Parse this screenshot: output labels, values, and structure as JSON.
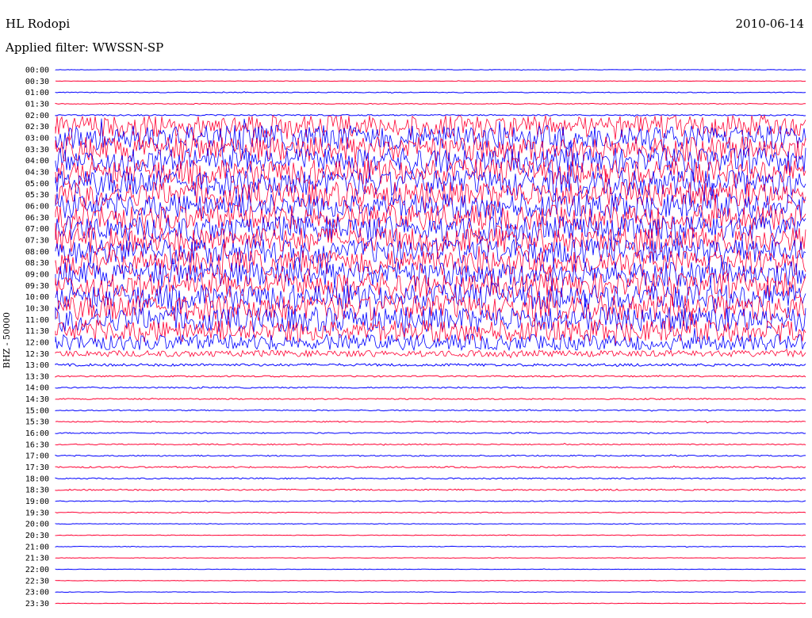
{
  "header": {
    "station": "HL Rodopi",
    "filter": "Applied filter: WWSSN-SP",
    "date": "2010-06-14"
  },
  "chart_data": {
    "type": "line",
    "ylabel": "BHZ - 50000",
    "series_colors": [
      "#0000ff",
      "#ff0033"
    ],
    "rows": [
      {
        "time": "00:00",
        "noise": 0.3
      },
      {
        "time": "00:30",
        "noise": 0.3
      },
      {
        "time": "01:00",
        "noise": 0.5
      },
      {
        "time": "01:30",
        "noise": 0.5
      },
      {
        "time": "02:00",
        "noise": 0.8
      },
      {
        "time": "02:30",
        "noise": 14
      },
      {
        "time": "03:00",
        "noise": 16
      },
      {
        "time": "03:30",
        "noise": 16
      },
      {
        "time": "04:00",
        "noise": 16
      },
      {
        "time": "04:30",
        "noise": 16
      },
      {
        "time": "05:00",
        "noise": 16
      },
      {
        "time": "05:30",
        "noise": 16
      },
      {
        "time": "06:00",
        "noise": 16
      },
      {
        "time": "06:30",
        "noise": 16
      },
      {
        "time": "07:00",
        "noise": 16
      },
      {
        "time": "07:30",
        "noise": 16
      },
      {
        "time": "08:00",
        "noise": 16
      },
      {
        "time": "08:30",
        "noise": 16
      },
      {
        "time": "09:00",
        "noise": 16
      },
      {
        "time": "09:30",
        "noise": 16
      },
      {
        "time": "10:00",
        "noise": 16
      },
      {
        "time": "10:30",
        "noise": 16
      },
      {
        "time": "11:00",
        "noise": 16
      },
      {
        "time": "11:30",
        "noise": 14
      },
      {
        "time": "12:00",
        "noise": 10
      },
      {
        "time": "12:30",
        "noise": 4
      },
      {
        "time": "13:00",
        "noise": 1.6
      },
      {
        "time": "13:30",
        "noise": 0.9
      },
      {
        "time": "14:00",
        "noise": 0.8
      },
      {
        "time": "14:30",
        "noise": 0.8
      },
      {
        "time": "15:00",
        "noise": 0.7
      },
      {
        "time": "15:30",
        "noise": 0.7
      },
      {
        "time": "16:00",
        "noise": 0.7
      },
      {
        "time": "16:30",
        "noise": 0.7
      },
      {
        "time": "17:00",
        "noise": 0.8
      },
      {
        "time": "17:30",
        "noise": 0.9
      },
      {
        "time": "18:00",
        "noise": 0.8
      },
      {
        "time": "18:30",
        "noise": 0.9
      },
      {
        "time": "19:00",
        "noise": 0.6
      },
      {
        "time": "19:30",
        "noise": 0.5
      },
      {
        "time": "20:00",
        "noise": 0.4
      },
      {
        "time": "20:30",
        "noise": 0.4
      },
      {
        "time": "21:00",
        "noise": 0.4
      },
      {
        "time": "21:30",
        "noise": 0.3
      },
      {
        "time": "22:00",
        "noise": 0.3
      },
      {
        "time": "22:30",
        "noise": 0.3
      },
      {
        "time": "23:00",
        "noise": 0.3
      },
      {
        "time": "23:30",
        "noise": 0.3
      }
    ]
  }
}
